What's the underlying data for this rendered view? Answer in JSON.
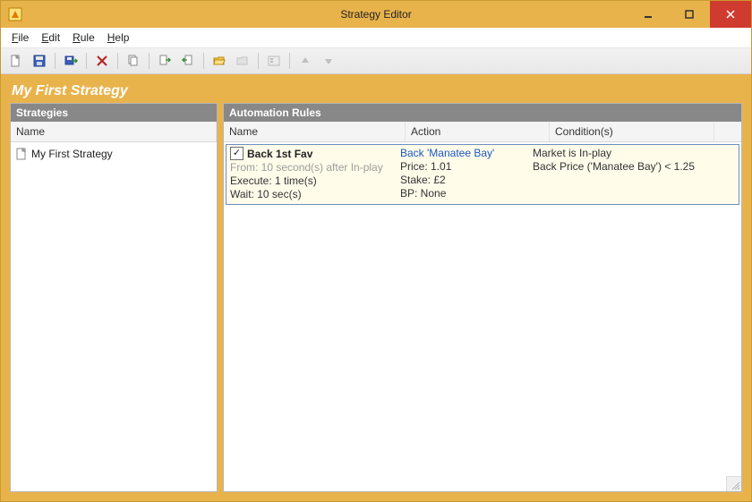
{
  "window": {
    "title": "Strategy Editor"
  },
  "menu": {
    "file": "File",
    "edit": "Edit",
    "rule": "Rule",
    "help": "Help"
  },
  "heading": "My First Strategy",
  "panels": {
    "left": {
      "title": "Strategies",
      "col": "Name",
      "items": [
        {
          "label": "My First Strategy"
        }
      ]
    },
    "right": {
      "title": "Automation Rules",
      "cols": {
        "name": "Name",
        "action": "Action",
        "cond": "Condition(s)"
      },
      "rules": [
        {
          "checked": "✓",
          "name": "Back 1st Fav",
          "from": "From: 10 second(s) after In-play",
          "execute": "Execute: 1 time(s)",
          "wait": "Wait: 10 sec(s)",
          "action_main": "Back 'Manatee Bay'",
          "price": "Price: 1.01",
          "stake": "Stake: £2",
          "bp": "BP: None",
          "cond1": "Market is In-play",
          "cond2": "Back Price ('Manatee Bay') < 1.25"
        }
      ]
    }
  }
}
